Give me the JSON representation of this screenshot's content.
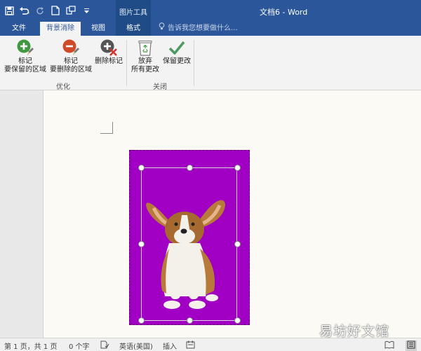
{
  "window": {
    "title": "文档6 - Word",
    "context_group": "图片工具"
  },
  "qat": {
    "icons": [
      "save-icon",
      "undo-icon",
      "redo-icon",
      "new-document-icon",
      "touch-mode-icon",
      "customize-qat-icon"
    ]
  },
  "tabs": {
    "file": "文件",
    "background_removal": "背景消除",
    "view": "视图",
    "format": "格式",
    "tell_me": "告诉我您想要做什么..."
  },
  "ribbon": {
    "mark_keep_line1": "标记",
    "mark_keep_line2": "要保留的区域",
    "mark_remove_line1": "标记",
    "mark_remove_line2": "要删除的区域",
    "delete_mark": "删除标记",
    "discard_line1": "放弃",
    "discard_line2": "所有更改",
    "keep_changes": "保留更改",
    "group_refine": "优化",
    "group_close": "关闭"
  },
  "status": {
    "page": "第 1 页，共 1 页",
    "words": "0 个字",
    "language": "英语(美国)",
    "insert": "插入"
  },
  "watermark": "易坊好文馆",
  "colors": {
    "accent": "#2b579a",
    "removal_overlay": "#a100c4"
  }
}
